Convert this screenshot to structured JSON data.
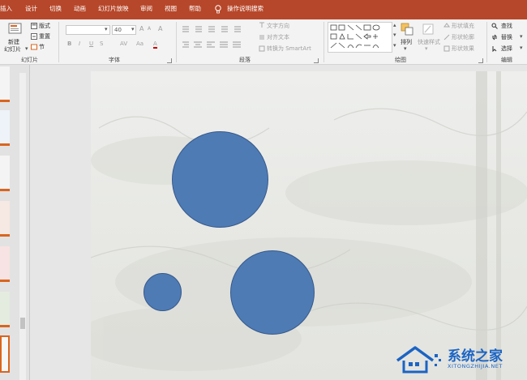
{
  "menu": {
    "tabs": [
      "插入",
      "设计",
      "切换",
      "动画",
      "幻灯片放映",
      "审阅",
      "视图",
      "帮助"
    ],
    "search_label": "操作说明搜索"
  },
  "ribbon": {
    "slides": {
      "new_slide": "新建",
      "new_slide_line2": "幻灯片",
      "layout": "版式",
      "reset": "重置",
      "section": "节",
      "group_label": "幻灯片"
    },
    "font": {
      "size_value": "40",
      "bold": "B",
      "italic": "I",
      "underline": "U",
      "strike": "S",
      "char_spacing": "AV",
      "case": "Aa",
      "clear_format": "A",
      "grow": "A",
      "shrink": "A",
      "group_label": "字体"
    },
    "paragraph": {
      "text_direction": "文字方向",
      "align_text": "对齐文本",
      "smartart": "转换为 SmartArt",
      "group_label": "段落"
    },
    "drawing": {
      "arrange": "排列",
      "quick_styles": "快速样式",
      "shape_fill": "形状填充",
      "shape_outline": "形状轮廓",
      "shape_effects": "形状效果",
      "group_label": "绘图"
    },
    "editing": {
      "find": "查找",
      "replace": "替换",
      "select": "选择",
      "group_label": "编辑"
    }
  },
  "watermark": {
    "cn": "系统之家",
    "en": "XITONGZHIJIA.NET"
  },
  "colors": {
    "accent": "#b7472a",
    "shape_fill": "#4f7bb5",
    "shape_border": "#35598c",
    "thumb_marker": "#d9651f",
    "watermark": "#1b64c4"
  }
}
